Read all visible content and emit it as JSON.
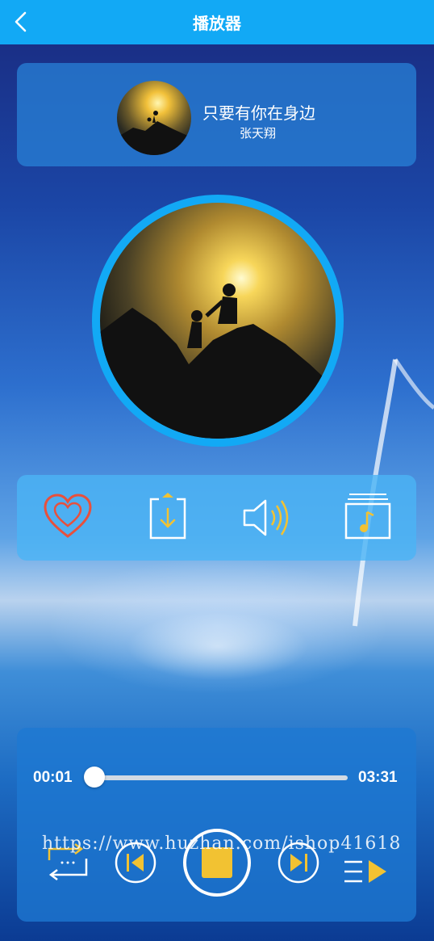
{
  "header": {
    "title": "播放器",
    "back_icon": "chevron-left-icon"
  },
  "song": {
    "title": "只要有你在身边",
    "artist": "张天翔"
  },
  "actions": [
    {
      "name": "favorite",
      "icon": "heart-icon",
      "color": "#e8503c"
    },
    {
      "name": "download",
      "icon": "download-icon",
      "color": "#f2c232"
    },
    {
      "name": "volume",
      "icon": "speaker-icon",
      "color": "#f2c232"
    },
    {
      "name": "playlist",
      "icon": "music-folder-icon",
      "color": "#f2c232"
    }
  ],
  "player": {
    "current_time": "00:01",
    "total_time": "03:31",
    "progress": 0.005,
    "controls": [
      "loop-icon",
      "previous-icon",
      "stop-icon",
      "next-icon",
      "queue-icon"
    ]
  },
  "watermark": "https://www.huzhan.com/ishop41618",
  "colors": {
    "accent": "#12a9f5",
    "icon_yellow": "#f2c232",
    "heart_red": "#e8503c"
  }
}
